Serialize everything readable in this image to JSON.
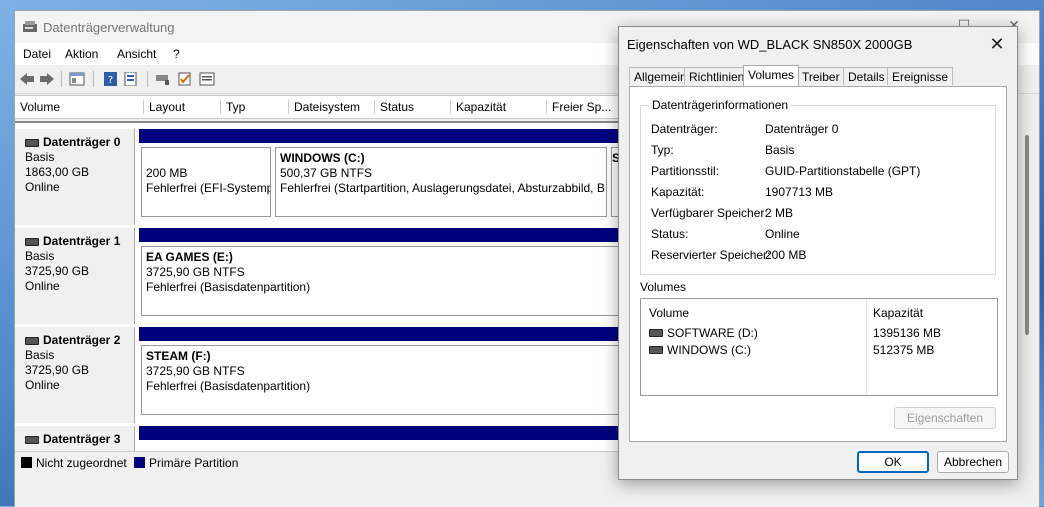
{
  "main": {
    "title": "Datenträgerverwaltung",
    "menu": [
      "Datei",
      "Aktion",
      "Ansicht",
      "?"
    ],
    "columns": [
      "Volume",
      "Layout",
      "Typ",
      "Dateisystem",
      "Status",
      "Kapazität",
      "Freier Sp..."
    ],
    "disks": [
      {
        "name": "Datenträger 0",
        "type": "Basis",
        "size": "1863,00 GB",
        "status": "Online",
        "partitions": [
          {
            "title": "",
            "line1": "200 MB",
            "line2": "Fehlerfrei (EFI-Systemp"
          },
          {
            "title": "WINDOWS  (C:)",
            "line1": "500,37 GB NTFS",
            "line2": "Fehlerfrei (Startpartition, Auslagerungsdatei, Absturzabbild, B"
          },
          {
            "title": "S",
            "line1": "",
            "line2": ""
          }
        ]
      },
      {
        "name": "Datenträger 1",
        "type": "Basis",
        "size": "3725,90 GB",
        "status": "Online",
        "partitions": [
          {
            "title": "EA GAMES  (E:)",
            "line1": "3725,90 GB NTFS",
            "line2": "Fehlerfrei (Basisdatenpartition)"
          }
        ]
      },
      {
        "name": "Datenträger 2",
        "type": "Basis",
        "size": "3725,90 GB",
        "status": "Online",
        "partitions": [
          {
            "title": "STEAM  (F:)",
            "line1": "3725,90 GB NTFS",
            "line2": "Fehlerfrei (Basisdatenpartition)"
          }
        ]
      },
      {
        "name": "Datenträger 3",
        "type": "",
        "size": "",
        "status": "",
        "partitions": []
      }
    ],
    "legend": {
      "unallocated": "Nicht zugeordnet",
      "primary": "Primäre Partition",
      "unallocated_color": "#000000",
      "primary_color": "#00007f"
    }
  },
  "dialog": {
    "title": "Eigenschaften von WD_BLACK SN850X 2000GB",
    "tabs": [
      "Allgemein",
      "Richtlinien",
      "Volumes",
      "Treiber",
      "Details",
      "Ereignisse"
    ],
    "active_tab": "Volumes",
    "group_label": "Datenträgerinformationen",
    "info": [
      {
        "key": "Datenträger:",
        "value": "Datenträger 0"
      },
      {
        "key": "Typ:",
        "value": "Basis"
      },
      {
        "key": "Partitionsstil:",
        "value": "GUID-Partitionstabelle (GPT)"
      },
      {
        "key": "Kapazität:",
        "value": "1907713 MB"
      },
      {
        "key": "Verfügbarer Speicher:",
        "value": "2 MB"
      },
      {
        "key": "Status:",
        "value": "Online"
      },
      {
        "key": "Reservierter Speicher:",
        "value": "200 MB"
      }
    ],
    "volumes_label": "Volumes",
    "volumes_headers": [
      "Volume",
      "Kapazität"
    ],
    "volumes": [
      {
        "name": "SOFTWARE (D:)",
        "capacity": "1395136 MB"
      },
      {
        "name": "WINDOWS (C:)",
        "capacity": "512375 MB"
      }
    ],
    "properties_button": "Eigenschaften",
    "ok_button": "OK",
    "cancel_button": "Abbrechen"
  }
}
